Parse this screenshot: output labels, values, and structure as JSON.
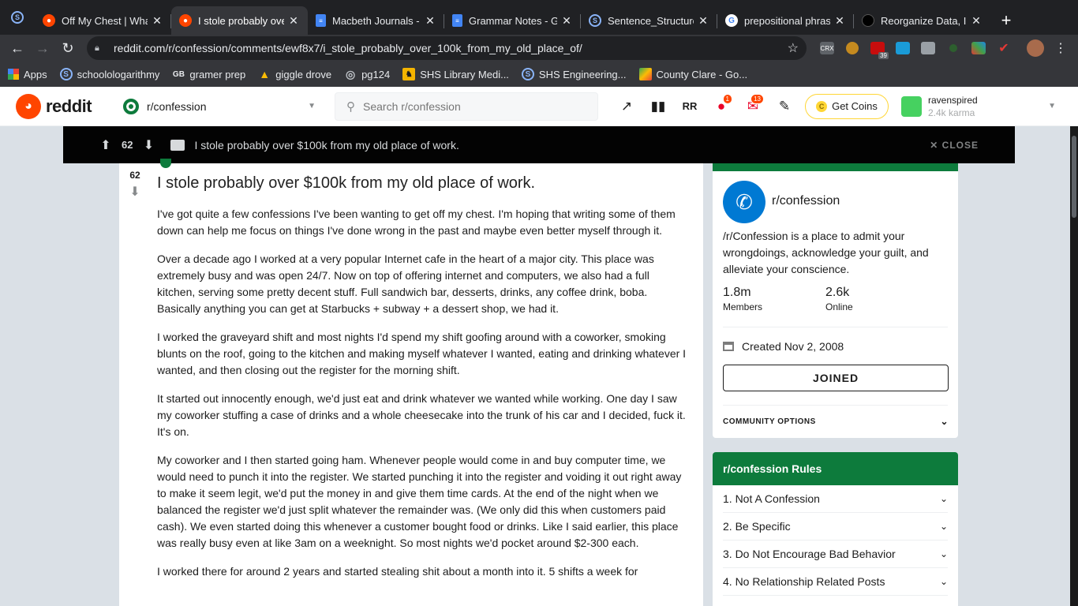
{
  "browser": {
    "tabs": [
      {
        "icon": "reddit",
        "title": "Off My Chest | Wha",
        "active": false
      },
      {
        "icon": "reddit",
        "title": "I stole probably ove",
        "active": true
      },
      {
        "icon": "doc",
        "title": "Macbeth Journals -",
        "active": false
      },
      {
        "icon": "doc",
        "title": "Grammar Notes - G",
        "active": false
      },
      {
        "icon": "s",
        "title": "Sentence_Structure",
        "active": false
      },
      {
        "icon": "g",
        "title": "prepositional phras",
        "active": false
      },
      {
        "icon": "gh",
        "title": "Reorganize Data, Im",
        "active": false
      }
    ],
    "url": "reddit.com/r/confession/comments/ewf8x7/i_stole_probably_over_100k_from_my_old_place_of/",
    "bookmarks": [
      {
        "icon": "apps",
        "label": "Apps"
      },
      {
        "icon": "s",
        "label": "schoolologarithmy"
      },
      {
        "icon": "gbi",
        "label": "gramer prep"
      },
      {
        "icon": "drive",
        "label": "giggle drove"
      },
      {
        "icon": "globe",
        "label": "pg124"
      },
      {
        "icon": "shs",
        "label": "SHS Library Medi..."
      },
      {
        "icon": "s",
        "label": "SHS Engineering..."
      },
      {
        "icon": "maps",
        "label": "County Clare - Go..."
      }
    ],
    "extensions": {
      "crx": "CRX",
      "badge_count": "39"
    }
  },
  "reddit_header": {
    "wordmark": "reddit",
    "subreddit": "r/confession",
    "search_placeholder": "Search r/confession",
    "chat_badge": "1",
    "inbox_badge": "13",
    "coins_label": "Get Coins",
    "username": "ravenspired",
    "karma": "2.4k karma"
  },
  "sticky_bar": {
    "score": "62",
    "title": "I stole probably over $100k from my old place of work.",
    "close_label": "CLOSE"
  },
  "post": {
    "score": "62",
    "title": "I stole probably over $100k from my old place of work.",
    "paragraphs": [
      "I've got quite a few confessions I've been wanting to get off my chest. I'm hoping that writing some of them down can help me focus on things I've done wrong in the past and maybe even better myself through it.",
      "Over a decade ago I worked at a very popular Internet cafe in the heart of a major city. This place was extremely busy and was open 24/7. Now on top of offering internet and computers, we also had a full kitchen, serving some pretty decent stuff. Full sandwich bar, desserts, drinks, any coffee drink, boba. Basically anything you can get at Starbucks + subway + a dessert shop, we had it.",
      "I worked the graveyard shift and most nights I'd spend my shift goofing around with a coworker, smoking blunts on the roof, going to the kitchen and making myself whatever I wanted, eating and drinking whatever I wanted, and then closing out the register for the morning shift.",
      "It started out innocently enough, we'd just eat and drink whatever we wanted while working. One day I saw my coworker stuffing a case of drinks and a whole cheesecake into the trunk of his car and I decided, fuck it. It's on.",
      "My coworker and I then started going ham. Whenever people would come in and buy computer time, we would need to punch it into the register. We started punching it into the register and voiding it out right away to make it seem legit, we'd put the money in and give them time cards. At the end of the night when we balanced the register we'd just split whatever the remainder was. (We only did this when customers paid cash). We even started doing this whenever a customer bought food or drinks. Like I said earlier, this place was really busy even at like 3am on a weeknight. So most nights we'd pocket around $2-300 each.",
      "I worked there for around 2 years and started stealing shit about a month into it. 5 shifts a week for"
    ]
  },
  "sidebar": {
    "name": "r/confession",
    "description": "/r/Confession is a place to admit your wrongdoings, acknowledge your guilt, and alleviate your conscience.",
    "members_value": "1.8m",
    "members_label": "Members",
    "online_value": "2.6k",
    "online_label": "Online",
    "created": "Created Nov 2, 2008",
    "joined_label": "JOINED",
    "community_options": "COMMUNITY OPTIONS",
    "rules_title": "r/confession Rules",
    "rules": [
      "1. Not A Confession",
      "2. Be Specific",
      "3. Do Not Encourage Bad Behavior",
      "4. No Relationship Related Posts"
    ]
  },
  "colors": {
    "subreddit_green": "#0d7b3c",
    "reddit_orange": "#ff4500",
    "sidebar_icon_blue": "#0079d3"
  }
}
